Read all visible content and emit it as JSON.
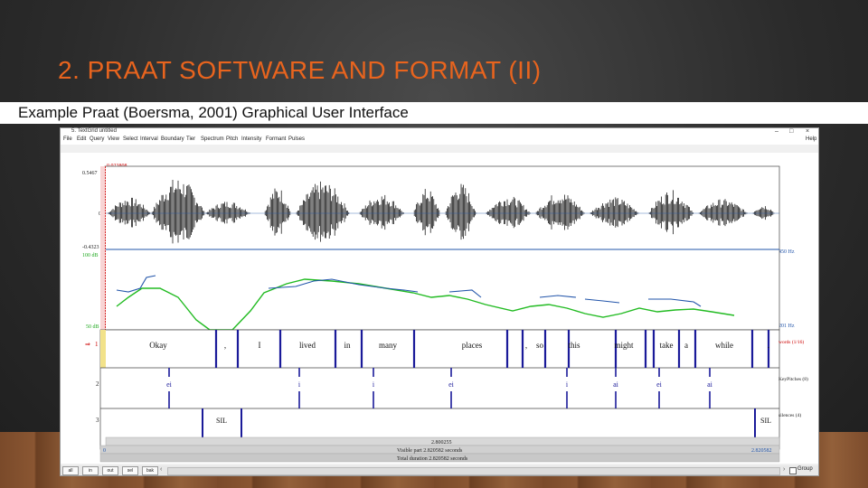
{
  "slide": {
    "title": "2. PRAAT SOFTWARE AND FORMAT (II)",
    "subtitle": "Example Praat (Boersma, 2001) Graphical User Interface"
  },
  "window": {
    "title": "5. TextGrid untitled",
    "controls": [
      "–",
      "□",
      "×"
    ],
    "help": "Help",
    "menu": [
      "File",
      "Edit",
      "Query",
      "View",
      "Select",
      "Interval",
      "Boundary",
      "Tier",
      "Spectrum",
      "Pitch",
      "Intensity",
      "Formant",
      "Pulses"
    ]
  },
  "editor": {
    "cursor_time": "0.023808",
    "wave_top": "0.5467",
    "wave_zero": "0",
    "wave_bottom": "-0.4323",
    "int_top": "100 dB",
    "int_bottom": "50 dB",
    "pitch_top": "450 Hz",
    "pitch_bottom": "201 Hz",
    "tier_numbers": [
      "1",
      "2",
      "3"
    ],
    "tier1_arrow": "⇒",
    "tier_names": [
      "words\n(1/16)",
      "KeyPitches\n(8)",
      "silences\n(4)"
    ],
    "words": [
      "Okay",
      ",",
      "I",
      "lived",
      "in",
      "many",
      "places",
      ",",
      "so",
      "this",
      "might",
      "take",
      "a",
      "while",
      "."
    ],
    "tier2_labels": [
      "ei",
      "i",
      "i",
      "ei",
      "i",
      "ai",
      "ei",
      "ai"
    ],
    "tier3_labels": [
      "SIL",
      "SIL"
    ],
    "selection_duration": "2.800255",
    "view_start": "0",
    "visible_part": "Visible part 2.820582 seconds",
    "view_end": "2.820582",
    "total_duration": "Total duration 2.820582 seconds"
  },
  "bottom": {
    "buttons": [
      "all",
      "in",
      "out",
      "sel",
      "bak"
    ],
    "group_label": "Group"
  },
  "colors": {
    "title": "#e8641e",
    "wave": "#000000",
    "pitch": "#2255aa",
    "intensity": "#22bb22",
    "boundary": "#1a1a99",
    "tier_label": "#1a1a99",
    "cursor": "#cc0000"
  }
}
